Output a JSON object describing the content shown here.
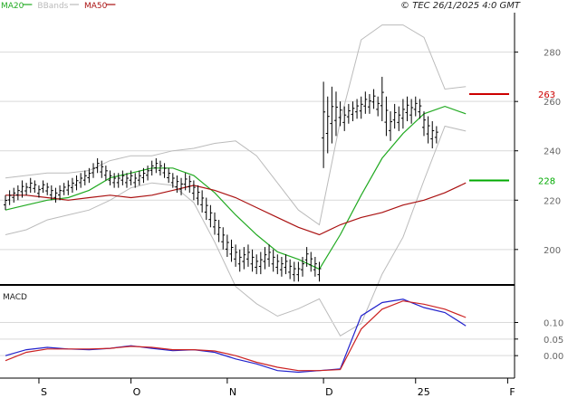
{
  "header": {
    "legend": [
      {
        "label": "MA20",
        "color": "#22aa22"
      },
      {
        "label": "BBands",
        "color": "#bbbbbb"
      },
      {
        "label": "MA50",
        "color": "#aa1111"
      }
    ],
    "copyright": "© TEC 26/1/2025 4:0 GMT"
  },
  "chart_data": [
    {
      "type": "ohlc",
      "name": "price",
      "ylim": [
        186,
        296
      ],
      "yticks": [
        200,
        220,
        240,
        260,
        280
      ],
      "grid": true,
      "x_labels": [
        "S",
        "O",
        "N",
        "D",
        "25",
        "F"
      ],
      "x_label_index": [
        8,
        30,
        53,
        76,
        98,
        120
      ],
      "level_lines": [
        {
          "label": "263",
          "value": 263,
          "color": "#cc0000"
        },
        {
          "label": "228",
          "value": 228,
          "color": "#00aa00"
        }
      ],
      "bars_hl": [
        [
          222,
          216
        ],
        [
          224,
          218
        ],
        [
          225,
          219
        ],
        [
          226,
          220
        ],
        [
          228,
          221
        ],
        [
          227,
          222
        ],
        [
          229,
          223
        ],
        [
          228,
          223
        ],
        [
          226,
          221
        ],
        [
          228,
          223
        ],
        [
          227,
          222
        ],
        [
          226,
          220
        ],
        [
          225,
          219
        ],
        [
          226,
          220
        ],
        [
          227,
          222
        ],
        [
          228,
          222
        ],
        [
          229,
          223
        ],
        [
          230,
          224
        ],
        [
          231,
          225
        ],
        [
          232,
          226
        ],
        [
          233,
          227
        ],
        [
          235,
          229
        ],
        [
          237,
          231
        ],
        [
          236,
          229
        ],
        [
          234,
          228
        ],
        [
          232,
          226
        ],
        [
          231,
          225
        ],
        [
          231,
          225
        ],
        [
          232,
          226
        ],
        [
          231,
          225
        ],
        [
          232,
          226
        ],
        [
          231,
          225
        ],
        [
          232,
          226
        ],
        [
          233,
          227
        ],
        [
          234,
          228
        ],
        [
          236,
          230
        ],
        [
          237,
          231
        ],
        [
          236,
          230
        ],
        [
          235,
          229
        ],
        [
          233,
          227
        ],
        [
          231,
          225
        ],
        [
          230,
          223
        ],
        [
          229,
          222
        ],
        [
          231,
          224
        ],
        [
          230,
          223
        ],
        [
          228,
          220
        ],
        [
          226,
          218
        ],
        [
          224,
          215
        ],
        [
          221,
          212
        ],
        [
          218,
          209
        ],
        [
          215,
          206
        ],
        [
          212,
          203
        ],
        [
          209,
          200
        ],
        [
          206,
          197
        ],
        [
          204,
          195
        ],
        [
          202,
          193
        ],
        [
          200,
          191
        ],
        [
          201,
          192
        ],
        [
          202,
          193
        ],
        [
          200,
          191
        ],
        [
          198,
          190
        ],
        [
          199,
          190
        ],
        [
          201,
          192
        ],
        [
          202,
          193
        ],
        [
          200,
          191
        ],
        [
          198,
          190
        ],
        [
          197,
          189
        ],
        [
          198,
          190
        ],
        [
          196,
          188
        ],
        [
          195,
          187
        ],
        [
          195,
          187
        ],
        [
          197,
          189
        ],
        [
          201,
          193
        ],
        [
          199,
          191
        ],
        [
          197,
          189
        ],
        [
          195,
          187
        ],
        [
          268,
          233
        ],
        [
          262,
          239
        ],
        [
          266,
          243
        ],
        [
          264,
          246
        ],
        [
          260,
          250
        ],
        [
          258,
          248
        ],
        [
          259,
          251
        ],
        [
          260,
          252
        ],
        [
          261,
          253
        ],
        [
          262,
          253
        ],
        [
          264,
          255
        ],
        [
          263,
          255
        ],
        [
          265,
          257
        ],
        [
          262,
          254
        ],
        [
          270,
          252
        ],
        [
          262,
          246
        ],
        [
          256,
          244
        ],
        [
          259,
          249
        ],
        [
          258,
          248
        ],
        [
          261,
          249
        ],
        [
          262,
          252
        ],
        [
          261,
          251
        ],
        [
          262,
          254
        ],
        [
          261,
          253
        ],
        [
          256,
          246
        ],
        [
          254,
          243
        ],
        [
          252,
          241
        ],
        [
          250,
          243
        ]
      ],
      "series": [
        {
          "name": "MA20",
          "color": "#22aa22",
          "values": [
            [
              0,
              216
            ],
            [
              5,
              218
            ],
            [
              10,
              220
            ],
            [
              15,
              221
            ],
            [
              20,
              224
            ],
            [
              25,
              229
            ],
            [
              30,
              231
            ],
            [
              35,
              233
            ],
            [
              40,
              233
            ],
            [
              45,
              230
            ],
            [
              50,
              223
            ],
            [
              55,
              214
            ],
            [
              60,
              206
            ],
            [
              65,
              199
            ],
            [
              70,
              196
            ],
            [
              75,
              192
            ],
            [
              80,
              206
            ],
            [
              85,
              222
            ],
            [
              90,
              237
            ],
            [
              95,
              247
            ],
            [
              100,
              255
            ],
            [
              105,
              258
            ],
            [
              110,
              255
            ]
          ]
        },
        {
          "name": "Upper band",
          "color": "#bbbbbb",
          "values": [
            [
              0,
              229
            ],
            [
              5,
              230
            ],
            [
              10,
              231
            ],
            [
              15,
              231
            ],
            [
              20,
              232
            ],
            [
              25,
              236
            ],
            [
              30,
              238
            ],
            [
              35,
              238
            ],
            [
              40,
              240
            ],
            [
              45,
              241
            ],
            [
              50,
              243
            ],
            [
              55,
              244
            ],
            [
              60,
              238
            ],
            [
              65,
              227
            ],
            [
              70,
              216
            ],
            [
              75,
              210
            ],
            [
              80,
              252
            ],
            [
              85,
              285
            ],
            [
              90,
              291
            ],
            [
              95,
              291
            ],
            [
              100,
              286
            ],
            [
              105,
              265
            ],
            [
              110,
              266
            ]
          ]
        },
        {
          "name": "Lower band",
          "color": "#bbbbbb",
          "values": [
            [
              0,
              206
            ],
            [
              5,
              208
            ],
            [
              10,
              212
            ],
            [
              15,
              214
            ],
            [
              20,
              216
            ],
            [
              25,
              220
            ],
            [
              30,
              225
            ],
            [
              35,
              227
            ],
            [
              40,
              226
            ],
            [
              45,
              219
            ],
            [
              50,
              203
            ],
            [
              55,
              185
            ],
            [
              60,
              178
            ],
            [
              65,
              173
            ],
            [
              70,
              176
            ],
            [
              75,
              180
            ],
            [
              80,
              165
            ],
            [
              85,
              170
            ],
            [
              90,
              190
            ],
            [
              95,
              205
            ],
            [
              100,
              228
            ],
            [
              105,
              250
            ],
            [
              110,
              248
            ]
          ]
        },
        {
          "name": "MA50",
          "color": "#aa1111",
          "values": [
            [
              0,
              222
            ],
            [
              5,
              222
            ],
            [
              10,
              221
            ],
            [
              15,
              220
            ],
            [
              20,
              221
            ],
            [
              25,
              222
            ],
            [
              30,
              221
            ],
            [
              35,
              222
            ],
            [
              40,
              224
            ],
            [
              45,
              226
            ],
            [
              50,
              224
            ],
            [
              55,
              221
            ],
            [
              60,
              217
            ],
            [
              65,
              213
            ],
            [
              70,
              209
            ],
            [
              75,
              206
            ],
            [
              80,
              210
            ],
            [
              85,
              213
            ],
            [
              90,
              215
            ],
            [
              95,
              218
            ],
            [
              100,
              220
            ],
            [
              105,
              223
            ],
            [
              110,
              227
            ]
          ]
        }
      ]
    },
    {
      "type": "line",
      "name": "macd",
      "title": "MACD",
      "ylim": [
        -0.065,
        0.205
      ],
      "yticks_labels": [
        {
          "label": "0.10",
          "value": 0.1
        },
        {
          "label": "0.05",
          "value": 0.05
        },
        {
          "label": "0.00",
          "value": 0.0
        }
      ],
      "series": [
        {
          "name": "MACD",
          "color": "#2222cc",
          "values": [
            [
              0,
              0.0
            ],
            [
              5,
              0.018
            ],
            [
              10,
              0.025
            ],
            [
              15,
              0.02
            ],
            [
              20,
              0.018
            ],
            [
              25,
              0.022
            ],
            [
              30,
              0.03
            ],
            [
              35,
              0.022
            ],
            [
              40,
              0.015
            ],
            [
              45,
              0.018
            ],
            [
              50,
              0.01
            ],
            [
              55,
              -0.01
            ],
            [
              60,
              -0.025
            ],
            [
              65,
              -0.045
            ],
            [
              70,
              -0.05
            ],
            [
              75,
              -0.045
            ],
            [
              80,
              -0.04
            ],
            [
              85,
              0.12
            ],
            [
              90,
              0.16
            ],
            [
              95,
              0.17
            ],
            [
              100,
              0.145
            ],
            [
              105,
              0.13
            ],
            [
              110,
              0.09
            ]
          ]
        },
        {
          "name": "Signal",
          "color": "#cc2222",
          "values": [
            [
              0,
              -0.015
            ],
            [
              5,
              0.01
            ],
            [
              10,
              0.02
            ],
            [
              15,
              0.02
            ],
            [
              20,
              0.02
            ],
            [
              25,
              0.022
            ],
            [
              30,
              0.028
            ],
            [
              35,
              0.025
            ],
            [
              40,
              0.018
            ],
            [
              45,
              0.018
            ],
            [
              50,
              0.014
            ],
            [
              55,
              0.0
            ],
            [
              60,
              -0.02
            ],
            [
              65,
              -0.035
            ],
            [
              70,
              -0.045
            ],
            [
              75,
              -0.045
            ],
            [
              80,
              -0.042
            ],
            [
              85,
              0.08
            ],
            [
              90,
              0.14
            ],
            [
              95,
              0.165
            ],
            [
              100,
              0.155
            ],
            [
              105,
              0.14
            ],
            [
              110,
              0.115
            ]
          ]
        }
      ]
    }
  ]
}
